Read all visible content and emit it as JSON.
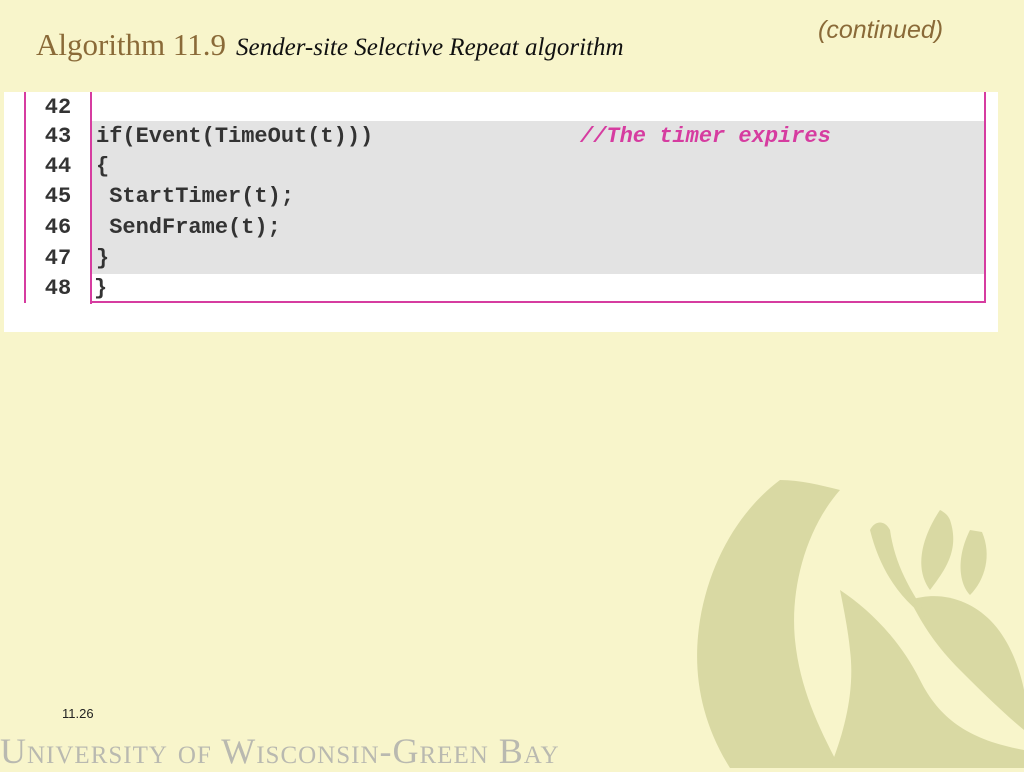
{
  "title": {
    "main": "Algorithm 11.9",
    "subtitle": "Sender-site Selective Repeat algorithm",
    "continued": "(continued)"
  },
  "code": {
    "lines": [
      {
        "number": "42",
        "code": "",
        "comment": "",
        "highlight": false
      },
      {
        "number": "43",
        "code": "if(Event(TimeOut(t)))",
        "comment": "//The timer expires",
        "highlight": true
      },
      {
        "number": "44",
        "code": "{",
        "comment": "",
        "highlight": true
      },
      {
        "number": "45",
        "code": " StartTimer(t);",
        "comment": "",
        "highlight": true
      },
      {
        "number": "46",
        "code": " SendFrame(t);",
        "comment": "",
        "highlight": true
      },
      {
        "number": "47",
        "code": "}",
        "comment": "",
        "highlight": true
      },
      {
        "number": "48",
        "code": "}",
        "comment": "",
        "highlight": false
      }
    ]
  },
  "footer": {
    "page_number": "11.26",
    "university": "University of Wisconsin-Green Bay"
  },
  "colors": {
    "background": "#f8f5cb",
    "accent_border": "#d63ca0",
    "title_brown": "#8a6a38",
    "highlight_gray": "#e3e3e3"
  },
  "icons": {
    "watermark": "phoenix-watermark-icon"
  }
}
